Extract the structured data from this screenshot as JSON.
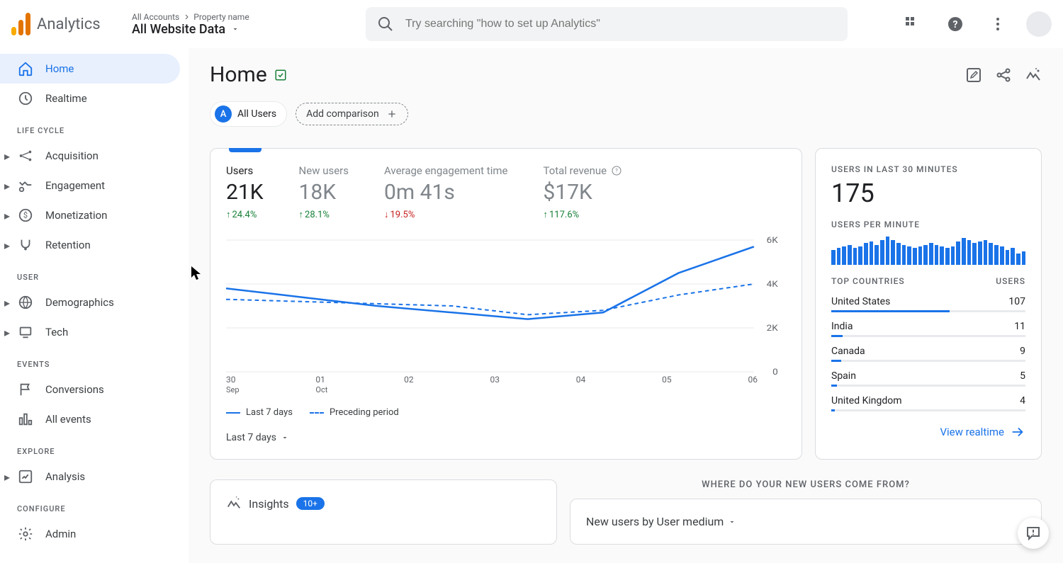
{
  "brand": "Analytics",
  "breadcrumb": {
    "all_accounts": "All Accounts",
    "property": "Property name",
    "view": "All Website Data"
  },
  "search": {
    "placeholder": "Try searching \"how to set up Analytics\""
  },
  "sidebar": {
    "home": "Home",
    "realtime": "Realtime",
    "sections": {
      "life_cycle": "LIFE CYCLE",
      "user": "USER",
      "events": "EVENTS",
      "explore": "EXPLORE",
      "configure": "CONFIGURE"
    },
    "acquisition": "Acquisition",
    "engagement": "Engagement",
    "monetization": "Monetization",
    "retention": "Retention",
    "demographics": "Demographics",
    "tech": "Tech",
    "conversions": "Conversions",
    "all_events": "All events",
    "analysis": "Analysis",
    "admin": "Admin"
  },
  "page": {
    "title": "Home",
    "chip_a": "A",
    "all_users": "All Users",
    "add_comparison": "Add comparison"
  },
  "metrics": {
    "users": {
      "label": "Users",
      "value": "21K",
      "change": "24.4%",
      "dir": "up"
    },
    "new_users": {
      "label": "New users",
      "value": "18K",
      "change": "28.1%",
      "dir": "up"
    },
    "avg_engagement": {
      "label": "Average engagement time",
      "value": "0m 41s",
      "change": "19.5%",
      "dir": "down"
    },
    "total_revenue": {
      "label": "Total revenue",
      "value": "$17K",
      "change": "117.6%",
      "dir": "up"
    }
  },
  "chart_data": {
    "type": "line",
    "x_labels": [
      "30",
      "01",
      "02",
      "03",
      "04",
      "05",
      "06"
    ],
    "x_sublabels": [
      "Sep",
      "Oct",
      "",
      "",
      "",
      "",
      ""
    ],
    "y_ticks": [
      "6K",
      "4K",
      "2K",
      "0"
    ],
    "ylim": [
      0,
      6000
    ],
    "series": [
      {
        "name": "Last 7 days",
        "style": "solid",
        "values": [
          3800,
          3400,
          3000,
          2700,
          2400,
          2700,
          4500,
          5700
        ]
      },
      {
        "name": "Preceding period",
        "style": "dashed",
        "values": [
          3300,
          3200,
          3100,
          3000,
          2600,
          2800,
          3500,
          4000
        ]
      }
    ]
  },
  "legend": {
    "current": "Last 7 days",
    "preceding": "Preceding period"
  },
  "date_range": "Last 7 days",
  "realtime_card": {
    "label": "USERS IN LAST 30 MINUTES",
    "value": "175",
    "per_minute_label": "USERS PER MINUTE",
    "spark": [
      18,
      20,
      22,
      24,
      20,
      22,
      26,
      28,
      24,
      30,
      34,
      30,
      26,
      24,
      22,
      20,
      22,
      24,
      26,
      24,
      22,
      20,
      22,
      28,
      32,
      30,
      26,
      28,
      30,
      26,
      24,
      22,
      18,
      20,
      14,
      16
    ],
    "countries_header": {
      "country": "TOP COUNTRIES",
      "users": "USERS"
    },
    "countries": [
      {
        "name": "United States",
        "users": "107",
        "pct": 61
      },
      {
        "name": "India",
        "users": "11",
        "pct": 6
      },
      {
        "name": "Canada",
        "users": "9",
        "pct": 5
      },
      {
        "name": "Spain",
        "users": "5",
        "pct": 3
      },
      {
        "name": "United Kingdom",
        "users": "4",
        "pct": 2
      }
    ],
    "view_link": "View realtime"
  },
  "bottom": {
    "section_title": "WHERE DO YOUR NEW USERS COME FROM?",
    "insights_label": "Insights",
    "insights_badge": "10+",
    "medium_label": "New users by User medium"
  }
}
